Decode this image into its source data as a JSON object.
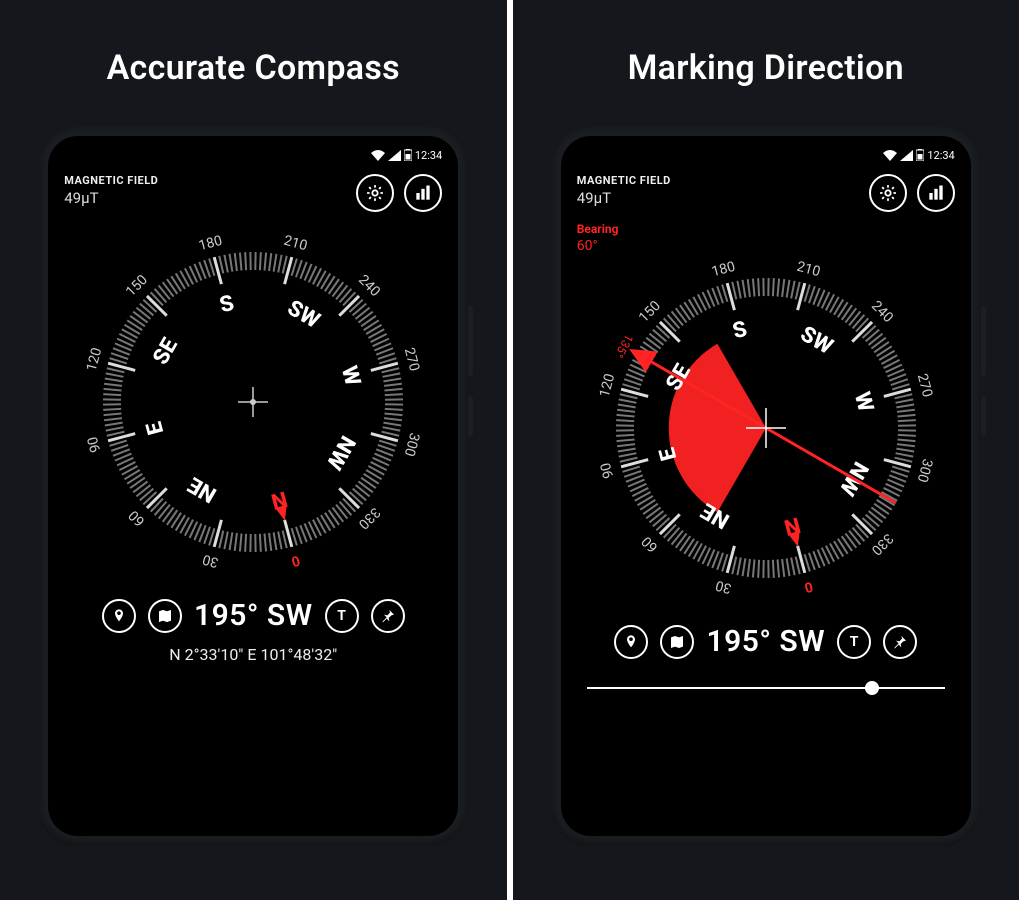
{
  "panes": {
    "left": {
      "title": "Accurate Compass"
    },
    "right": {
      "title": "Marking Direction"
    }
  },
  "status_bar": {
    "time": "12:34"
  },
  "header": {
    "mf_label": "MAGNETIC FIELD",
    "mf_value": "49µT"
  },
  "bearing": {
    "label": "Bearing",
    "value": "60°",
    "marker_degree_text": "135°"
  },
  "compass": {
    "heading_offset_deg": 195,
    "degree_labels": [
      "0",
      "30",
      "60",
      "90",
      "120",
      "150",
      "180",
      "210",
      "240",
      "270",
      "300",
      "330"
    ],
    "cardinal_labels": [
      "N",
      "NE",
      "E",
      "SE",
      "S",
      "SW",
      "W",
      "NW"
    ]
  },
  "footer": {
    "heading_text": "195° SW",
    "coords_text": "N 2°33'10\" E 101°48'32\"",
    "t_label": "T"
  },
  "slider": {
    "value_pct": 78
  },
  "colors": {
    "accent": "#ff2323"
  }
}
